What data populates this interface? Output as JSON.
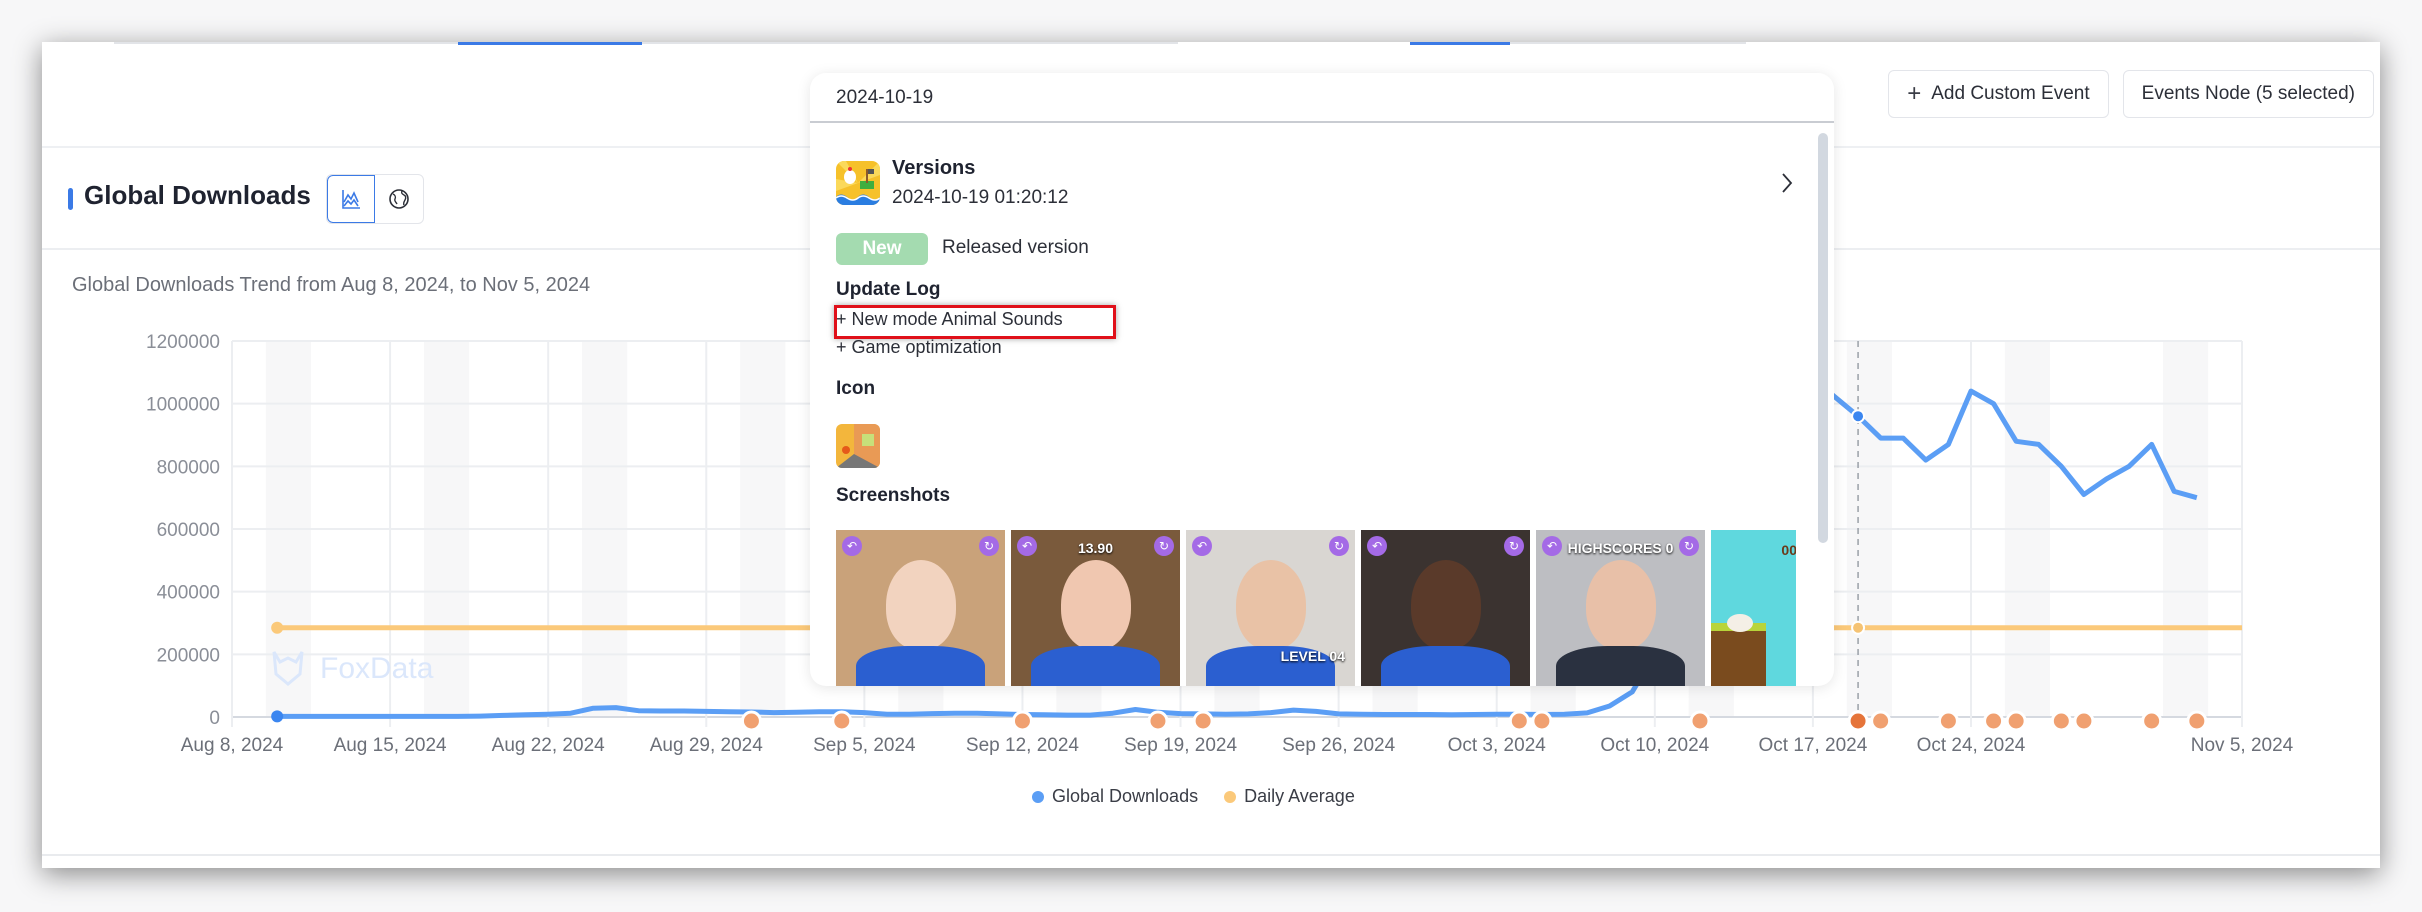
{
  "header": {
    "add_custom_event_label": "Add Custom Event",
    "events_node_label": "Events Node (5 selected)"
  },
  "card": {
    "title": "Global Downloads",
    "view_toggle": [
      {
        "icon": "area-chart-icon",
        "active": true
      },
      {
        "icon": "globe-icon",
        "active": false
      }
    ],
    "subtitle": "Global Downloads Trend from Aug 8, 2024, to Nov 5, 2024",
    "watermark": "FoxData"
  },
  "popup": {
    "date": "2024-10-19",
    "versions_title": "Versions",
    "versions_time": "2024-10-19 01:20:12",
    "badge": "New",
    "badge_text": "Released version",
    "update_log_title": "Update Log",
    "update_log": [
      "+ New mode Animal Sounds",
      "+ Game optimization"
    ],
    "icon_title": "Icon",
    "screenshots_title": "Screenshots",
    "screenshots": [
      {
        "caption": "",
        "bg": "#c9a27a"
      },
      {
        "caption": "13.90",
        "bg": "#7a5a3c"
      },
      {
        "caption": "LEVEL 04",
        "bg": "#d9d6d2"
      },
      {
        "caption": "",
        "bg": "#3b3330"
      },
      {
        "caption": "HIGHSCORES 0",
        "bg": "#bdbec2"
      },
      {
        "caption": "00",
        "bg": "#5fd8de"
      }
    ]
  },
  "legend": [
    {
      "label": "Global Downloads",
      "color": "#5b9ef5"
    },
    {
      "label": "Daily Average",
      "color": "#fbc97a"
    }
  ],
  "chart_data": {
    "type": "line",
    "title": "Global Downloads Trend from Aug 8, 2024, to Nov 5, 2024",
    "xlabel": "",
    "ylabel": "",
    "ylim": [
      0,
      1200000
    ],
    "yticks": [
      "0",
      "200000",
      "400000",
      "600000",
      "800000",
      "1000000",
      "1200000"
    ],
    "xticks": [
      "Aug 8, 2024",
      "Aug 15, 2024",
      "Aug 22, 2024",
      "Aug 29, 2024",
      "Sep 5, 2024",
      "Sep 12, 2024",
      "Sep 19, 2024",
      "Sep 26, 2024",
      "Oct 3, 2024",
      "Oct 10, 2024",
      "Oct 17, 2024",
      "Oct 24, 2024",
      "Nov 5, 2024"
    ],
    "x_start": "2024-08-08",
    "x_days": 89,
    "grid": true,
    "legend": "bottom",
    "highlighted_date": "2024-10-19",
    "series": [
      {
        "name": "Global Downloads",
        "color": "#5b9ef5",
        "start_day": 2,
        "values": [
          2000,
          2000,
          2000,
          2000,
          2000,
          2000,
          2000,
          2000,
          2000,
          3000,
          5000,
          7000,
          9000,
          12000,
          28000,
          30000,
          20000,
          19000,
          19000,
          18000,
          17000,
          16000,
          14000,
          15000,
          17000,
          17000,
          14000,
          9000,
          9000,
          11000,
          12000,
          12000,
          10000,
          8000,
          7000,
          6000,
          6000,
          12000,
          24000,
          15000,
          11000,
          10000,
          9000,
          10000,
          14000,
          22000,
          18000,
          10000,
          9000,
          8000,
          8000,
          8000,
          7000,
          8000,
          9000,
          9000,
          8000,
          9000,
          13000,
          35000,
          80000,
          200000,
          380000,
          520000,
          600000,
          680000,
          760000,
          880000,
          1080000,
          1020000,
          960000,
          890000,
          890000,
          820000,
          870000,
          1040000,
          1000000,
          880000,
          870000,
          800000,
          710000,
          760000,
          800000,
          870000,
          720000,
          700000
        ]
      },
      {
        "name": "Daily Average",
        "color": "#fbc97a",
        "start_day": 2,
        "constant": 285000
      }
    ],
    "event_markers_days": [
      23,
      27,
      35,
      41,
      43,
      57,
      58,
      65,
      72,
      73,
      76,
      78,
      79,
      81,
      82,
      85,
      87
    ],
    "event_markers_highlight_day": 72,
    "weekend_bands": true
  }
}
